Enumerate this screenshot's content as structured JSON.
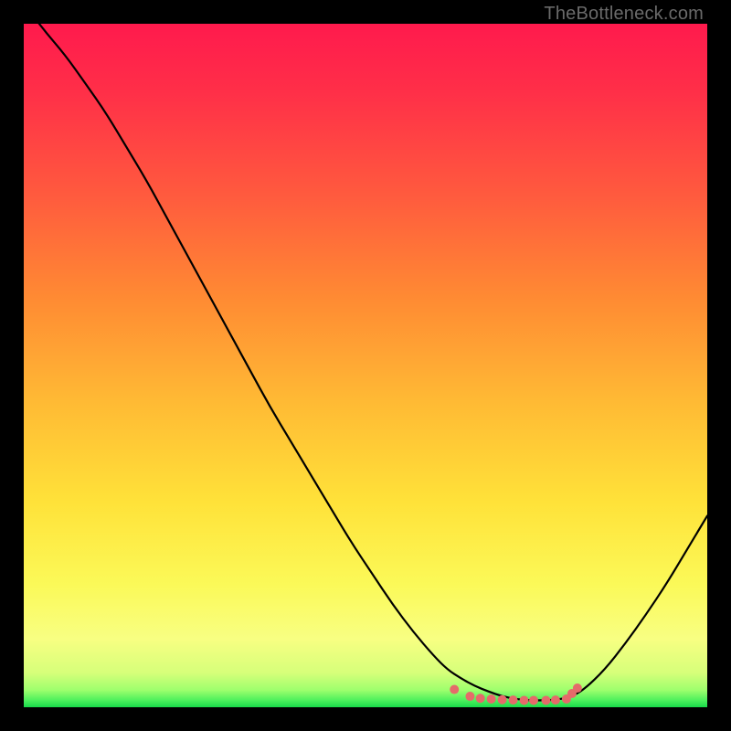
{
  "watermark": "TheBottleneck.com",
  "chart_data": {
    "type": "line",
    "title": "",
    "xlabel": "",
    "ylabel": "",
    "xlim": [
      0,
      100
    ],
    "ylim": [
      0,
      100
    ],
    "background": {
      "type": "vertical-gradient",
      "stops": [
        {
          "offset": 0.0,
          "color": "#ff1a4d"
        },
        {
          "offset": 0.1,
          "color": "#ff2f48"
        },
        {
          "offset": 0.25,
          "color": "#ff5a3e"
        },
        {
          "offset": 0.4,
          "color": "#ff8a33"
        },
        {
          "offset": 0.55,
          "color": "#ffb934"
        },
        {
          "offset": 0.7,
          "color": "#ffe239"
        },
        {
          "offset": 0.82,
          "color": "#fbf958"
        },
        {
          "offset": 0.9,
          "color": "#f8ff82"
        },
        {
          "offset": 0.95,
          "color": "#d6ff7a"
        },
        {
          "offset": 0.975,
          "color": "#9dff6d"
        },
        {
          "offset": 0.99,
          "color": "#4cf05c"
        },
        {
          "offset": 1.0,
          "color": "#17d94a"
        }
      ]
    },
    "series": [
      {
        "name": "curve",
        "color": "#000000",
        "x": [
          0,
          3,
          6,
          9,
          12,
          15,
          18,
          21,
          24,
          27,
          30,
          33,
          36,
          39,
          42,
          45,
          48,
          51,
          54,
          57,
          60,
          62,
          64,
          66,
          68,
          70,
          72,
          74,
          76,
          78,
          80,
          82,
          85,
          88,
          91,
          94,
          97,
          100
        ],
        "y": [
          103,
          99,
          95.5,
          91.3,
          87,
          82,
          77,
          71.5,
          66,
          60.5,
          55,
          49.5,
          44,
          39,
          34,
          29,
          24,
          19.5,
          15,
          11,
          7.5,
          5.5,
          4.2,
          3.1,
          2.3,
          1.6,
          1.2,
          1.0,
          1.0,
          1.1,
          1.5,
          2.6,
          5.5,
          9.3,
          13.5,
          18,
          23,
          28
        ]
      }
    ],
    "markers": {
      "name": "valley-dots",
      "color": "#e56a6a",
      "radius_px": 5,
      "x": [
        63.0,
        65.3,
        66.8,
        68.4,
        70.0,
        71.6,
        73.2,
        74.6,
        76.4,
        77.8,
        79.4,
        80.2,
        81.0
      ],
      "y": [
        2.6,
        1.6,
        1.3,
        1.2,
        1.1,
        1.05,
        1.0,
        1.0,
        1.0,
        1.05,
        1.2,
        2.0,
        2.8
      ]
    }
  }
}
